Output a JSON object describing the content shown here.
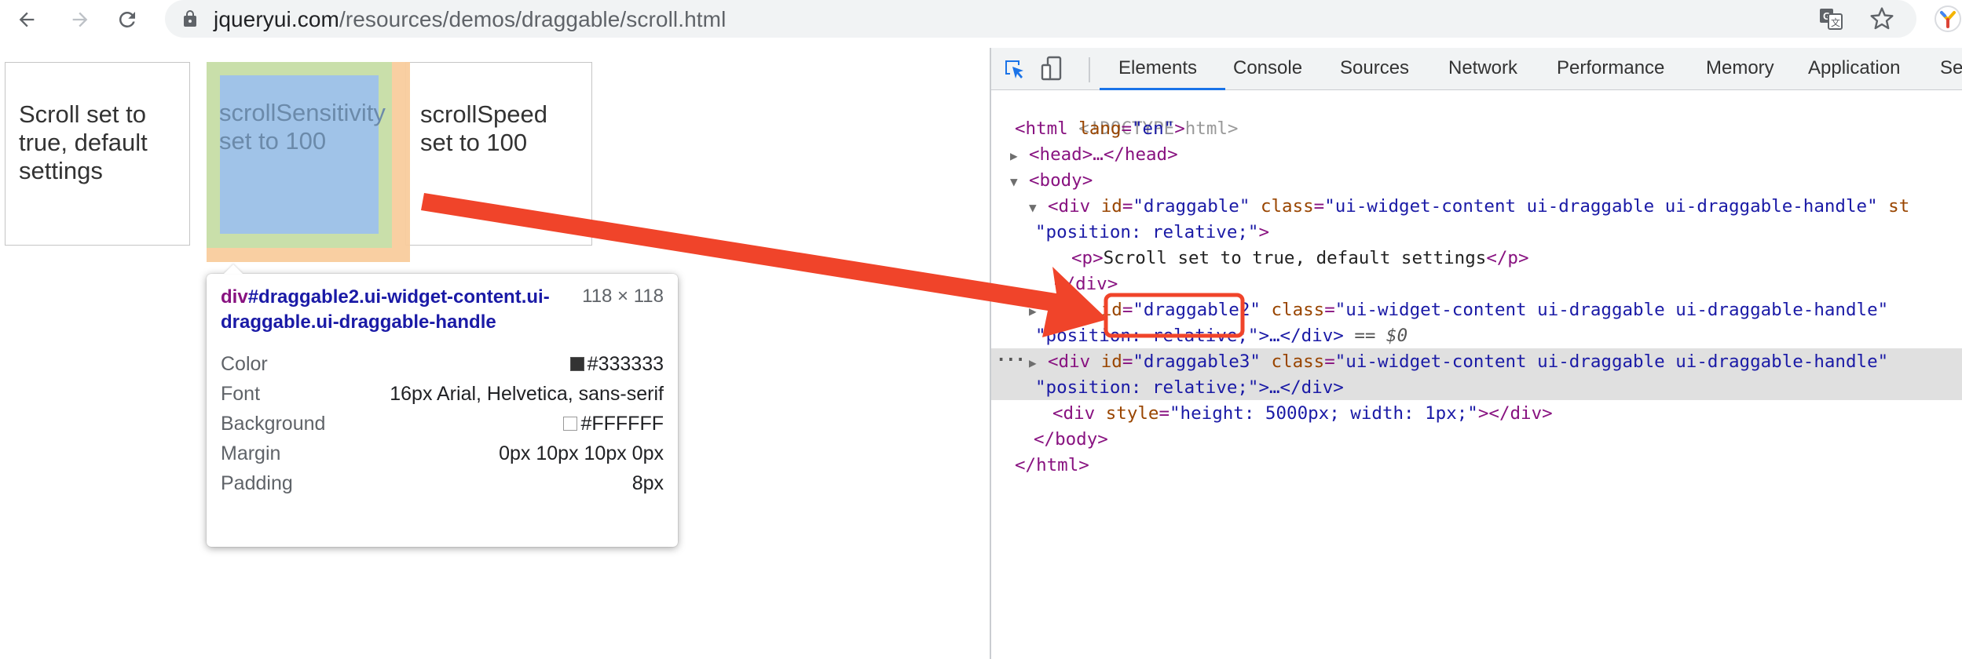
{
  "browser": {
    "url_host": "jqueryui.com",
    "url_path": "/resources/demos/draggable/scroll.html"
  },
  "page": {
    "box1_text": "Scroll set to true, default settings",
    "box2_text": "scrollSensitivity\nset to 100",
    "box3_text": "scrollSpeed set to 100"
  },
  "tooltip": {
    "selector_tag": "div",
    "selector_rest": "#draggable2.ui-widget-content.ui-draggable.ui-draggable-handle",
    "size": "118 × 118",
    "rows": [
      {
        "key": "Color",
        "value": "#333333",
        "swatch": "#333333"
      },
      {
        "key": "Font",
        "value": "16px Arial, Helvetica, sans-serif"
      },
      {
        "key": "Background",
        "value": "#FFFFFF",
        "swatch": "#FFFFFF"
      },
      {
        "key": "Margin",
        "value": "0px 10px 10px 0px"
      },
      {
        "key": "Padding",
        "value": "8px"
      }
    ]
  },
  "devtools": {
    "tabs": [
      "Elements",
      "Console",
      "Sources",
      "Network",
      "Performance",
      "Memory",
      "Application",
      "Se"
    ],
    "active_tab": "Elements",
    "dom": {
      "doctype": "<!DOCTYPE html>",
      "html_open_tag": "html",
      "html_lang_attr": "lang",
      "html_lang_val": "\"en\"",
      "head_collapsed": "<head>…</head>",
      "body_open": "<body>",
      "div_tag": "div",
      "id_attr": "id",
      "class_attr": "class",
      "style_attr": "style",
      "draggable_id": "\"draggable\"",
      "draggable2_id": "\"draggable2\"",
      "draggable3_id": "\"draggable3\"",
      "class_val": "\"ui-widget-content ui-draggable ui-draggable-handle\"",
      "style_trunc": " st",
      "position_val": "\"position: relative;\"",
      "position_val_close": "\"position: relative;\">…</div>",
      "p_text": "Scroll set to true, default settings",
      "selected_marker": "== $0",
      "spacer_style": "\"height: 5000px; width: 1px;\"",
      "body_close": "</body>",
      "html_close": "</html>",
      "div_close": "</div>"
    }
  },
  "colors": {
    "highlight_margin": "#f9cc9d",
    "highlight_border": "#c9dfaa",
    "highlight_content": "#a0c3e8",
    "annotation_red": "#f0442a",
    "active_tab_blue": "#1a73e8"
  }
}
